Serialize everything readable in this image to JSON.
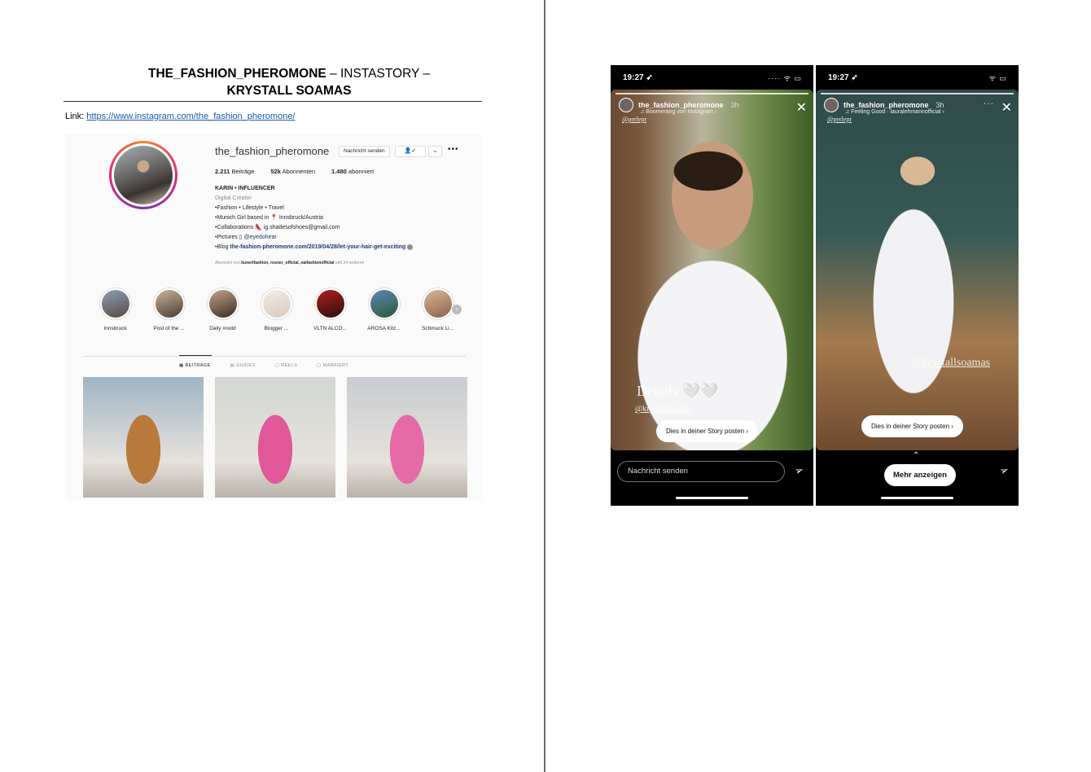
{
  "doc": {
    "title_bold_1": "THE_FASHION_PHEROMONE",
    "title_mid": " – INSTASTORY – ",
    "title_bold_2": "KRYSTALL SOAMAS",
    "link_label": "Link: ",
    "link_url": "https://www.instagram.com/the_fashion_pheromone/"
  },
  "profile": {
    "username": "the_fashion_pheromone",
    "message_button": "Nachricht senden",
    "follow_icon": "user-check-icon",
    "chevron": "⌄",
    "more": "•••",
    "stats": {
      "posts_value": "2.211",
      "posts_label": "Beiträge",
      "followers_value": "52k",
      "followers_label": "Abonnenten",
      "following_value": "1.480",
      "following_label": "abonniert"
    },
    "bio": {
      "name": "KARIN • INFLUENCER",
      "category": "Digital Creator",
      "line1": "•Fashion • Lifestyle • Travel",
      "line2_prefix": "•Munich Girl based in ",
      "line2_suffix": " Innsbruck/Austria",
      "line3_prefix": "•Collaborations ",
      "line3_suffix": " ig.shadesofshoes@gmail.com",
      "line4_prefix": "•Pictures ▯ ",
      "line4_mention": "@eyedohear",
      "line5_prefix": "•Blog ",
      "line5_link": "the-fashion-pheromone.com/2019/04/28/let-your-hair-get-exciting"
    },
    "followed_by_prefix": "Abonniert von ",
    "followed_by_names": "kunertfashion, rosner_official, oaifashionofficial",
    "followed_by_suffix": " und 34 weiteren",
    "highlights": [
      {
        "label": "Innsbruck",
        "color1": "#8aa0b8",
        "color2": "#5a4a40"
      },
      {
        "label": "Post of the ...",
        "color1": "#c7b59a",
        "color2": "#4d3c33"
      },
      {
        "label": "Daily #ootd",
        "color1": "#c5a58b",
        "color2": "#3b2a22"
      },
      {
        "label": "Blogger ...",
        "color1": "#f3ede7",
        "color2": "#d8c9bd"
      },
      {
        "label": "VLTN ALCO...",
        "color1": "#b01e1e",
        "color2": "#2a0f0f"
      },
      {
        "label": "AROSA Kitz...",
        "color1": "#5a86b8",
        "color2": "#2f5a3a"
      },
      {
        "label": "Schmuck Li...",
        "color1": "#d8b69a",
        "color2": "#8a6448"
      }
    ],
    "tabs": {
      "posts": "▦ BEITRÄGE",
      "guides": "▤ GUIDES",
      "reels": "▢ REELS",
      "tagged": "▢ MARKIERT"
    },
    "posts": [
      {
        "color1": "#9fb4c4",
        "color2": "#b87a3a"
      },
      {
        "color1": "#d2d6d2",
        "color2": "#e0579a"
      },
      {
        "color1": "#c8ccd0",
        "color2": "#e66aa6"
      }
    ]
  },
  "story1": {
    "time": "19:27 ➶",
    "status_icons": "···· ᯤ ▭",
    "username": "the_fashion_pheromone",
    "age": "3h",
    "subtitle": "♫ Boomerang von Instagram ›",
    "tag": "@perlepr",
    "overlay_text": "Details 🤍🤍",
    "overlay_handle": "@krystallsoamas",
    "post_story_button": "Dies in deiner Story posten  ›",
    "message_placeholder": "Nachricht senden",
    "send_icon": "send-icon"
  },
  "story2": {
    "time": "19:27 ➶",
    "status_icons": "ᯤ ▭",
    "username": "the_fashion_pheromone",
    "age": "3h",
    "subtitle": "♫ Feeling Good · lauralehmannofficial ›",
    "tag": "@perlepr",
    "more": "···",
    "overlay_handle": "@krystallsoamas",
    "post_story_button": "Dies in deiner Story posten  ›",
    "more_button": "Mehr anzeigen",
    "chevron_up": "⌃",
    "send_icon": "send-icon"
  }
}
